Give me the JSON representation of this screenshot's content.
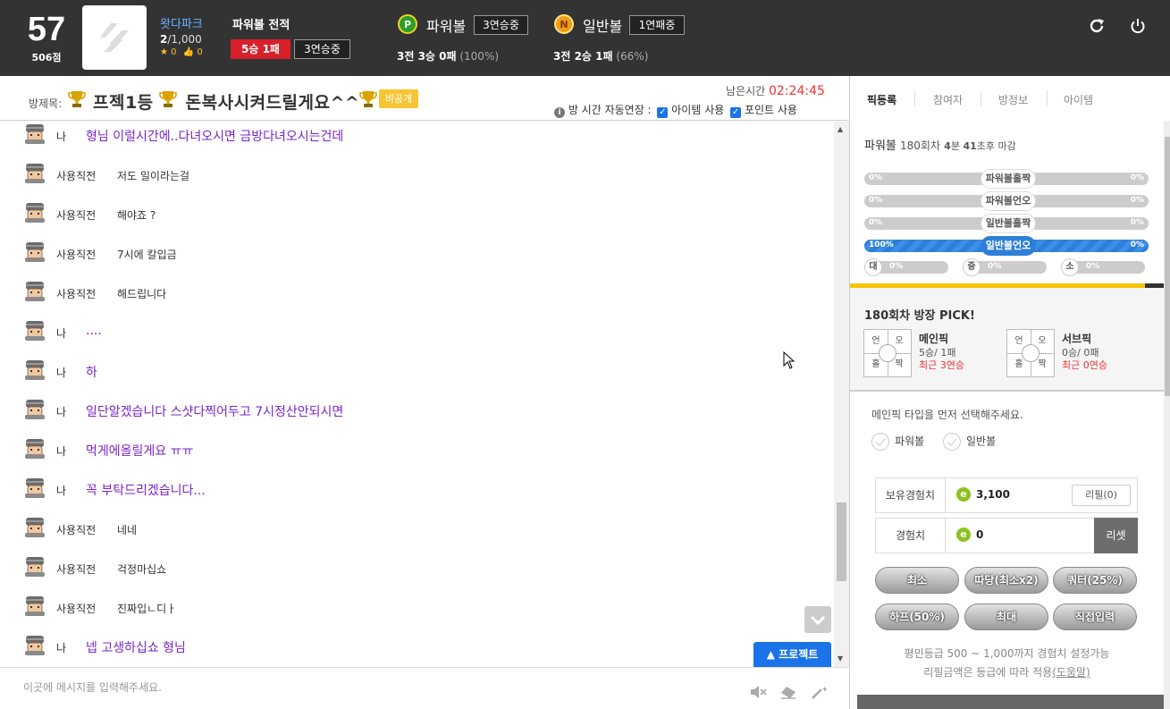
{
  "user": {
    "level": "57",
    "points": "506점",
    "name": "왓다파크",
    "count_current": "2",
    "count_total": "/1,000",
    "stars": "0",
    "likes": "0"
  },
  "record": {
    "title": "파워볼 전적",
    "win_loss": "5승 1패",
    "streak": "3연승중"
  },
  "powerball": {
    "coin": "P",
    "name": "파워볼",
    "streak": "3연승중",
    "record": "3전 3승 0패",
    "pct": "(100%)"
  },
  "normalball": {
    "coin": "N",
    "name": "일반볼",
    "streak": "1연패중",
    "record": "3전 2승 1패",
    "pct": "(66%)"
  },
  "room": {
    "label": "방제목:",
    "title": "프젝1등",
    "subtitle": "돈복사시켜드릴게요^^",
    "private": "비공개",
    "remain_label": "남은시간",
    "remain_time": "02:24:45",
    "auto_extend": "방 시간 자동연장 :",
    "opt_item": "아이템 사용",
    "opt_point": "포인트 사용"
  },
  "chat": {
    "messages": [
      {
        "nick": "나",
        "text": "형님 이럴시간에..다녀오시면 금방다녀오시는건데"
      },
      {
        "nick": "사용직전",
        "text": "저도 일이라는걸"
      },
      {
        "nick": "사용직전",
        "text": "해야죠 ?"
      },
      {
        "nick": "사용직전",
        "text": "7시에 칼입금"
      },
      {
        "nick": "사용직전",
        "text": "해드립니다"
      },
      {
        "nick": "나",
        "text": "...."
      },
      {
        "nick": "나",
        "text": "하"
      },
      {
        "nick": "나",
        "text": "일단알겠습니다 스샷다찍어두고 7시정산안되시면"
      },
      {
        "nick": "나",
        "text": "먹게에올릴게요 ㅠㅠ"
      },
      {
        "nick": "나",
        "text": "꼭 부탁드리겠습니다..."
      },
      {
        "nick": "사용직전",
        "text": "네네"
      },
      {
        "nick": "사용직전",
        "text": "걱정마십쇼"
      },
      {
        "nick": "사용직전",
        "text": "진짜입ㄴ디ㅏ"
      },
      {
        "nick": "나",
        "text": "넵 고생하십쇼 형님"
      }
    ],
    "project_button": "프로젝트",
    "input_placeholder": "이곳에 메시지를 입력해주세요."
  },
  "tabs": [
    "픽등록",
    "참여자",
    "방정보",
    "아이템"
  ],
  "bet": {
    "game": "파워볼",
    "round": "180회차",
    "remain_min": "4",
    "remain_min_unit": "분",
    "remain_sec": "41",
    "remain_sec_unit": "초후 마감",
    "bars": [
      {
        "tag": "파워볼홀짝",
        "left": "0%",
        "right": "0%",
        "fill": 0
      },
      {
        "tag": "파워볼언오",
        "left": "0%",
        "right": "0%",
        "fill": 0
      },
      {
        "tag": "일반볼홀짝",
        "left": "0%",
        "right": "0%",
        "fill": 0
      },
      {
        "tag": "일반볼언오",
        "left": "100%",
        "right": "0%",
        "fill": 1
      }
    ],
    "size_bars": [
      {
        "label": "대",
        "pct": "0%"
      },
      {
        "label": "중",
        "pct": "0%"
      },
      {
        "label": "소",
        "pct": "0%"
      }
    ]
  },
  "pick": {
    "title": "180회차 방장 PICK!",
    "grid": [
      "언",
      "오",
      "홀",
      "짝"
    ],
    "main": {
      "name": "메인픽",
      "record": "5승/ 1패",
      "recent": "최근 3연승"
    },
    "sub": {
      "name": "서브픽",
      "record": "0승/ 0패",
      "recent": "최근 0연승"
    }
  },
  "select": {
    "hint": "메인픽 타입을 먼저 선택해주세요.",
    "opt1": "파워볼",
    "opt2": "일반볼"
  },
  "exp": {
    "own_label": "보유경험치",
    "own_icon": "e",
    "own_value": "3,100",
    "refill": "리필(0)",
    "exp_label": "경험치",
    "exp_icon": "e",
    "exp_value": "0",
    "reset": "리셋",
    "buttons": [
      "최소",
      "따당(최소x2)",
      "쿼터(25%)",
      "하프(50%)",
      "최대",
      "직접입력"
    ],
    "note1": "평민등급 500 ~ 1,000까지 경험치 설정가능",
    "note2_pre": "리필금액은 등급에 따라 적용",
    "note2_link": "(도움말)"
  },
  "colors": {
    "topbar": "#333333",
    "win_red": "#d7202a",
    "remain_red": "#e33333",
    "chat_me": "#7a24c9",
    "accent_blue": "#1a73e8",
    "yellow": "#f6c602"
  }
}
